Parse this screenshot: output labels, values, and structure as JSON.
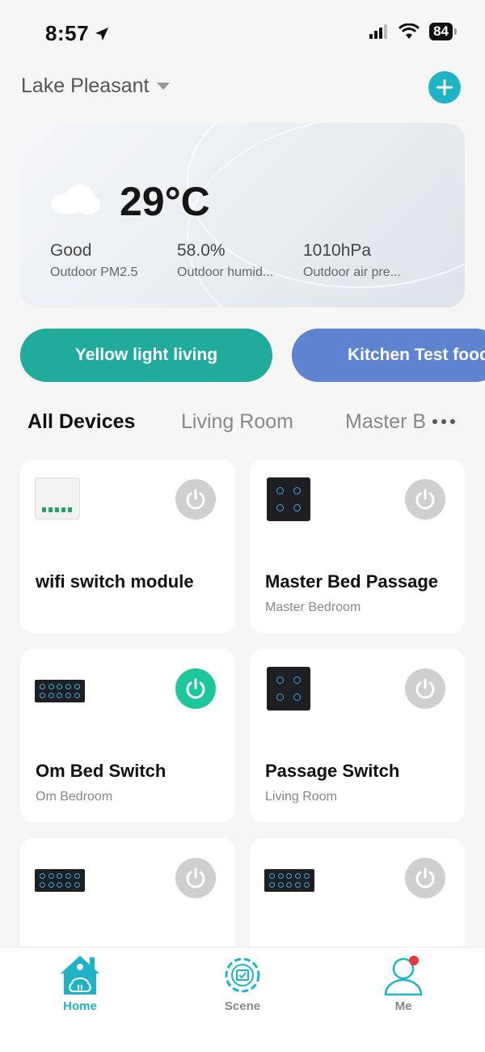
{
  "status_bar": {
    "time": "8:57",
    "battery": "84",
    "location_icon": "location-arrow-icon",
    "signal_icon": "cellular-signal-icon",
    "wifi_icon": "wifi-icon"
  },
  "header": {
    "home_name": "Lake Pleasant",
    "dropdown_icon": "caret-down-icon",
    "add_icon": "plus-icon",
    "accent_color": "#1fb3c7"
  },
  "weather": {
    "icon": "cloud-icon",
    "temperature": "29°C",
    "metrics": [
      {
        "value": "Good",
        "label": "Outdoor PM2.5"
      },
      {
        "value": "58.0%",
        "label": "Outdoor humid..."
      },
      {
        "value": "1010hPa",
        "label": "Outdoor air pre..."
      }
    ]
  },
  "scenes": [
    {
      "label": "Yellow light living",
      "color": "#20ab9c"
    },
    {
      "label": "Kitchen Test food",
      "color": "#5d83d1"
    }
  ],
  "tabs": {
    "items": [
      "All Devices",
      "Living Room",
      "Master B"
    ],
    "active": "All Devices",
    "more_icon": "more-dots-icon"
  },
  "devices": [
    {
      "name": "wifi switch module",
      "room": "",
      "power": "off",
      "thumb": "switch-module"
    },
    {
      "name": "Master Bed Passage",
      "room": "Master Bedroom",
      "power": "off",
      "thumb": "4-gang-panel"
    },
    {
      "name": "Om Bed Switch",
      "room": "Om Bedroom",
      "power": "on",
      "thumb": "10-gang-panel"
    },
    {
      "name": "Passage Switch",
      "room": "Living Room",
      "power": "off",
      "thumb": "4-gang-panel"
    },
    {
      "name": "",
      "room": "",
      "power": "off",
      "thumb": "10-gang-panel"
    },
    {
      "name": "",
      "room": "",
      "power": "off",
      "thumb": "10-gang-panel"
    }
  ],
  "power_colors": {
    "on": "#1dc799",
    "off": "#cfcfcf"
  },
  "bottom_nav": [
    {
      "label": "Home",
      "icon": "home-icon",
      "active": true
    },
    {
      "label": "Scene",
      "icon": "scene-gear-icon",
      "active": false
    },
    {
      "label": "Me",
      "icon": "user-profile-icon",
      "active": false
    }
  ]
}
